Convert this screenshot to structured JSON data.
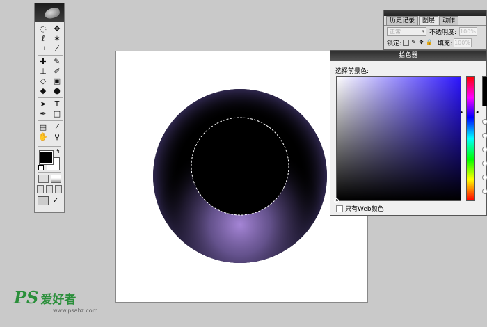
{
  "toolbox": {
    "tools": [
      {
        "name": "elliptical-marquee-icon",
        "glyph": "◌"
      },
      {
        "name": "move-icon",
        "glyph": "✥"
      },
      {
        "name": "lasso-icon",
        "glyph": "ℓ"
      },
      {
        "name": "magic-wand-icon",
        "glyph": "✶"
      },
      {
        "name": "crop-icon",
        "glyph": "⌗"
      },
      {
        "name": "slice-icon",
        "glyph": "⁄"
      },
      {
        "name": "healing-brush-icon",
        "glyph": "✚"
      },
      {
        "name": "brush-icon",
        "glyph": "✎"
      },
      {
        "name": "clone-stamp-icon",
        "glyph": "⊥"
      },
      {
        "name": "history-brush-icon",
        "glyph": "✐"
      },
      {
        "name": "eraser-icon",
        "glyph": "◇"
      },
      {
        "name": "gradient-icon",
        "glyph": "▣"
      },
      {
        "name": "blur-icon",
        "glyph": "◆"
      },
      {
        "name": "dodge-icon",
        "glyph": "●"
      },
      {
        "name": "path-selection-icon",
        "glyph": "➤"
      },
      {
        "name": "text-icon",
        "glyph": "T"
      },
      {
        "name": "pen-icon",
        "glyph": "✒"
      },
      {
        "name": "rectangle-shape-icon",
        "glyph": "□"
      },
      {
        "name": "notes-icon",
        "glyph": "▤"
      },
      {
        "name": "eyedropper-icon",
        "glyph": "⁄"
      },
      {
        "name": "hand-icon",
        "glyph": "✋"
      },
      {
        "name": "zoom-icon",
        "glyph": "⚲"
      }
    ],
    "swap_glyph": "↰",
    "imageready_glyph": "✓",
    "foreground_color": "#000000",
    "background_color": "#ffffff"
  },
  "layers_panel": {
    "tabs": [
      "历史记录",
      "图层",
      "动作"
    ],
    "active_tab": "图层",
    "blend_mode": "正常",
    "opacity_label": "不透明度:",
    "opacity_value": "100%",
    "lock_label": "锁定:",
    "fill_label": "填充:",
    "fill_value": "100%"
  },
  "color_picker": {
    "title": "拾色器",
    "prompt": "选择前景色:",
    "web_colors_label": "只有Web颜色",
    "hue_color": "#2d16ff",
    "selected_color": "#000000"
  },
  "watermark": {
    "logo": "PS",
    "title": "爱好者",
    "url": "www.psahz.com"
  },
  "canvas": {
    "background": "#ffffff",
    "circle_dark": "#000000",
    "circle_glow": "#9a78c8"
  }
}
